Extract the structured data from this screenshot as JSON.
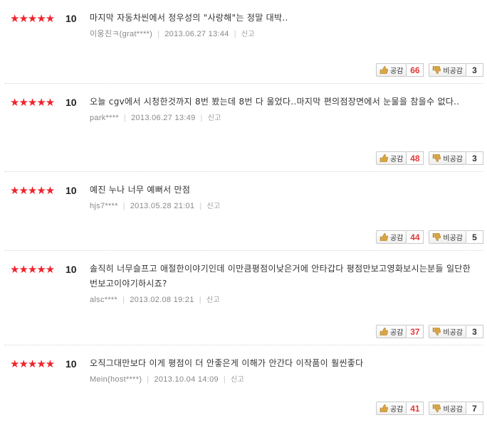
{
  "reviews": [
    {
      "stars": "★★★★★",
      "score": "10",
      "text": "마지막 자동차씬에서 정우성의 \"사랑해\"는 정말 대박..",
      "user": "이웅진ㅋ(grat****)",
      "date": "2013.06.27 13:44",
      "report": "신고",
      "like_label": "공감",
      "like_count": "66",
      "dislike_label": "비공감",
      "dislike_count": "3"
    },
    {
      "stars": "★★★★★",
      "score": "10",
      "text": "오늘 cgv에서 시청한것까지 8번 봤는데 8번 다 울었다..마지막 편의점장면에서 눈물을 참을수 없다..",
      "user": "park****",
      "date": "2013.06.27 13:49",
      "report": "신고",
      "like_label": "공감",
      "like_count": "48",
      "dislike_label": "비공감",
      "dislike_count": "3"
    },
    {
      "stars": "★★★★★",
      "score": "10",
      "text": "예진 누나 너무 예뻐서 만점",
      "user": "hjs7****",
      "date": "2013.05.28 21:01",
      "report": "신고",
      "like_label": "공감",
      "like_count": "44",
      "dislike_label": "비공감",
      "dislike_count": "5"
    },
    {
      "stars": "★★★★★",
      "score": "10",
      "text": "솔직히 너무슬프고 애절한이야기인데 이만큼평점이낮은거에 안타갑다 평점만보고영화보시는분들 일단한번보고이야기하시죠?",
      "user": "alsc****",
      "date": "2013.02.08 19:21",
      "report": "신고",
      "like_label": "공감",
      "like_count": "37",
      "dislike_label": "비공감",
      "dislike_count": "3"
    },
    {
      "stars": "★★★★★",
      "score": "10",
      "text": "오직그대만보다 이게 평점이 더 안좋은게 이해가 안간다 이작품이 훨씬좋다",
      "user": "Mein(host****)",
      "date": "2013.10.04 14:09",
      "report": "신고",
      "like_label": "공감",
      "like_count": "41",
      "dislike_label": "비공감",
      "dislike_count": "7"
    }
  ],
  "colors": {
    "star": "#f0232b",
    "like_count": "#e03a3a",
    "dislike_count": "#333333"
  },
  "icons": {
    "like": "thumbs-up-icon",
    "dislike": "thumbs-down-icon"
  }
}
